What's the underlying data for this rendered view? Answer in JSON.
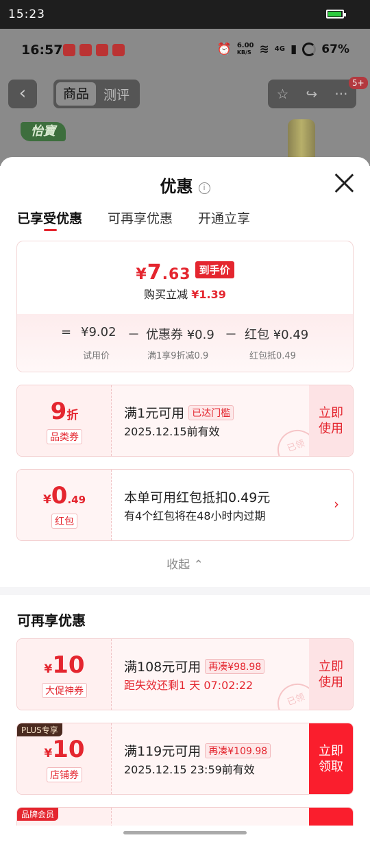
{
  "outer_status": {
    "time": "15:23"
  },
  "bg_status": {
    "time": "16:57",
    "net_speed_top": "6.00",
    "net_speed_bottom": "KB/S",
    "net_type": "4G",
    "battery": "67%"
  },
  "bg_nav": {
    "back": "‹",
    "tab_active": "商品",
    "tab_other": "测评",
    "fav_icon": "☆",
    "share_icon": "↪",
    "more_icon": "···",
    "badge": "5+",
    "logo": "怡寶"
  },
  "sheet": {
    "title": "优惠",
    "info": "i",
    "tabs": [
      "已享受优惠",
      "可再享优惠",
      "开通立享"
    ],
    "summary": {
      "final_symbol": "¥",
      "final_int": "7",
      "final_dec": ".63",
      "final_tag": "到手价",
      "reduce_label": "购买立减",
      "reduce_value": "¥1.39",
      "eq": "=",
      "trial_price": "¥9.02",
      "minus1": "－",
      "coupon_part": "优惠券 ¥0.9",
      "minus2": "－",
      "redpack_part": "红包 ¥0.49",
      "trial_label": "试用价",
      "coupon_label": "满1享9折减0.9",
      "redpack_label": "红包抵0.49"
    },
    "enjoyed": [
      {
        "amount": "9",
        "unit": "折",
        "label": "品类券",
        "title": "满1元可用",
        "pill": "已达门槛",
        "sub": "2025.12.15前有效",
        "action_line1": "立即",
        "action_line2": "使用",
        "stamp": "已领"
      },
      {
        "prefix": "¥",
        "amount": "0",
        "decimal": ".49",
        "label": "红包",
        "title": "本单可用红包抵扣0.49元",
        "sub": "有4个红包将在48小时内过期",
        "chevron": "›"
      }
    ],
    "collapse": "收起 ⌃",
    "more_title": "可再享优惠",
    "more": [
      {
        "prefix": "¥",
        "amount": "10",
        "label": "大促神券",
        "title": "满108元可用",
        "pill": "再凑¥98.98",
        "sub": "距失效还剩1 天 07:02:22",
        "action_line1": "立即",
        "action_line2": "使用",
        "stamp": "已领"
      },
      {
        "tag": "PLUS专享",
        "prefix": "¥",
        "amount": "10",
        "label": "店铺券",
        "title": "满119元可用",
        "pill": "再凑¥109.98",
        "sub": "2025.12.15 23:59前有效",
        "action_line1": "立即",
        "action_line2": "领取"
      },
      {
        "tag": "品牌会员"
      }
    ]
  },
  "colors": {
    "accent": "#e4262f",
    "solid_button": "#fa1e2d"
  }
}
